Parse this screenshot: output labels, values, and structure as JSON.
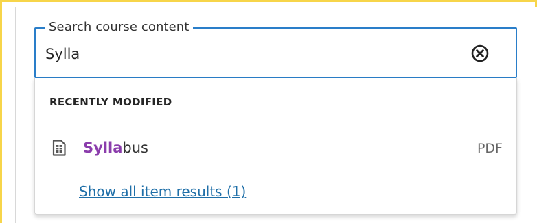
{
  "search": {
    "label": "Search course content",
    "value": "Sylla",
    "clear_icon": "clear-circle-x-icon"
  },
  "dropdown": {
    "section_heading": "RECENTLY MODIFIED",
    "results": [
      {
        "match": "Sylla",
        "rest": "bus",
        "type": "PDF",
        "icon": "document-icon"
      }
    ],
    "show_all_label": "Show all item results (1)"
  },
  "colors": {
    "focus_border": "#2a7ec9",
    "highlight": "#8b3dac",
    "link": "#1f6fa8",
    "frame_highlight": "#f7d54a"
  }
}
